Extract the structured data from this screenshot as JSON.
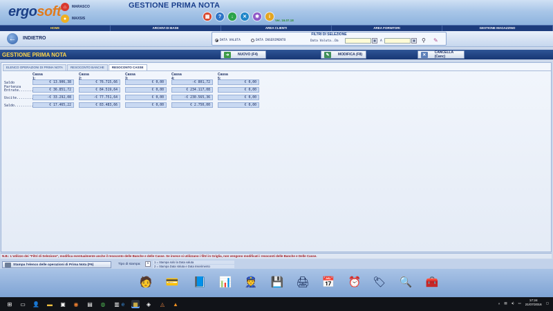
{
  "header": {
    "logo_main": "ergo",
    "logo_tail": "soft",
    "user1": "MARASCO",
    "user2": "MAXSIS",
    "title": "GESTIONE PRIMA NOTA",
    "version": "Ver. 16.07.18",
    "tool_icons": [
      "calendar-icon",
      "help-icon",
      "download-icon",
      "close-icon",
      "settings-icon",
      "info-icon"
    ]
  },
  "menu": [
    "HOME",
    "ARCHIVI DI BASE",
    "AREA CLIENTI",
    "AREA FORNITORI",
    "GESTIONE MAGAZZINO"
  ],
  "subbar": {
    "back_label": "INDIETRO",
    "filters_title": "FILTRI DI SELEZIONE",
    "radio_valuta": "DATA VALUTA",
    "radio_inserimento": "DATA INSERIMENTO",
    "date_from_label": "Data Valuta..Da",
    "date_to_label": "A"
  },
  "section": {
    "title": "GESTIONE PRIMA NOTA",
    "btn_new": "NUOVO (F4)",
    "btn_edit": "MODIFICA (F8)",
    "btn_delete": "CANCELLA (Canc)"
  },
  "tabs": [
    "ELENCO OPERAZIONI DI PRIMA NOTA",
    "RESOCONTO BANCHE",
    "RESOCONTO CASSE"
  ],
  "resoconto": {
    "columns": [
      "Cassa 1: 000001",
      "Cassa 2: 000002",
      "Cassa 3: 000003",
      "Cassa 4: 000004",
      "Cassa 5: ABB"
    ],
    "rows": [
      {
        "label": "Saldo Partenza",
        "values": [
          "€ 13.906,38",
          "€ 76.715,66",
          "€ 0,00",
          "-€ 801,72",
          "€ 0,00"
        ]
      },
      {
        "label": "Entrate........",
        "values": [
          "€ 36.851,72",
          "€ 84.519,64",
          "€ 0,00",
          "€ 234.117,08",
          "€ 0,00"
        ]
      },
      {
        "label": "Uscite..........",
        "values": [
          "-€ 33.292,08",
          "-€ 77.751,64",
          "€ 0,00",
          "-€ 230.565,36",
          "€ 0,00"
        ]
      },
      {
        "label": "Saldo...........",
        "values": [
          "€ 17.465,22",
          "€ 83.483,66",
          "€ 0,00",
          "€ 2.750,00",
          "€ 0,00"
        ]
      }
    ]
  },
  "note": "N.B.: L'utilizzo dei \"Filtri di Selezione\", modifica eventualmente anche il resoconto delle Banche e delle Casse. Se invece si utilizzano i filtri in Griglia, non vengono modificati i resoconti delle Banche e Delle Casse.",
  "print": {
    "button": "Stampa l'elenco delle operazioni di Prima Nota (F6)",
    "tipo_label": "Tipo di stampa:",
    "tipo_value": "1",
    "opt1": "1 = Stampa solo la Data valuta",
    "opt2": "2 = Stampa Data Valuta e Data Inserimento"
  },
  "launcher_icons": [
    "user-icon",
    "card-icon",
    "binder-icon",
    "chart-icon",
    "security-icon",
    "database-icon",
    "printer-icon",
    "calendar-icon",
    "clock-icon",
    "tag-icon",
    "search-icon",
    "toolbox-icon"
  ],
  "taskbar": {
    "time": "17:24",
    "date": "21/07/2016"
  }
}
